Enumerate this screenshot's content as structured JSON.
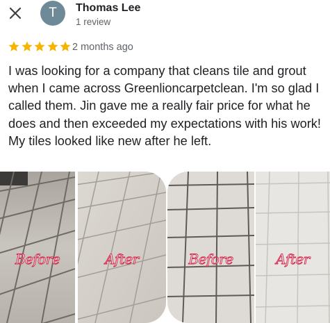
{
  "icons": {
    "close": "close-icon",
    "star": "star-icon"
  },
  "colors": {
    "star": "#f4b400",
    "avatar_bg": "#6e8a99",
    "caption": "#d7264c"
  },
  "reviewer": {
    "initial": "T",
    "name": "Thomas Lee",
    "review_count": "1 review"
  },
  "review": {
    "rating": 5,
    "date": "2 months ago",
    "text": "I was looking for a company that cleans tile and grout when I came across Greenlioncarpetclean. I'm so glad I called them. Jin gave me a really fair price for what he does and then exceeded my expectations with his work! My tiles looked like new after he left."
  },
  "photos": [
    {
      "caption": "Before"
    },
    {
      "caption": "After"
    },
    {
      "caption": "Before"
    },
    {
      "caption": "After"
    }
  ]
}
